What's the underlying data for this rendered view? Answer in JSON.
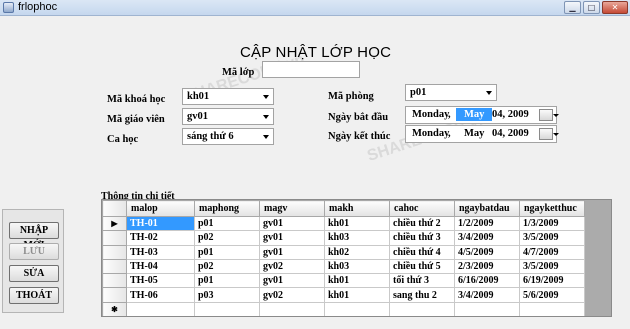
{
  "window": {
    "title": "frlophoc"
  },
  "heading": "CẬP NHẬT  LỚP HỌC",
  "fields": {
    "ma_lop": {
      "label": "Mã lớp",
      "value": ""
    },
    "ma_khoa_hoc": {
      "label": "Mã khoá học",
      "value": "kh01"
    },
    "ma_giao_vien": {
      "label": "Mã giáo viên",
      "value": "gv01"
    },
    "ca_hoc": {
      "label": "Ca học",
      "value": "sáng thứ 6"
    },
    "ma_phong": {
      "label": "Mã phòng",
      "value": "p01"
    },
    "ngay_bat_dau": {
      "label": "Ngày bắt đầu",
      "weekday": "Monday",
      "sep": ",",
      "month": "May",
      "day_year": "04, 2009"
    },
    "ngay_ket_thuc": {
      "label": "Ngày kết thúc",
      "weekday": "Monday",
      "sep": ",",
      "month": "May",
      "day_year": "04, 2009"
    }
  },
  "buttons": {
    "nhap_moi": "NHẬP MỚI",
    "luu": "LƯU",
    "sua": "SỬA",
    "thoat": "THOÁT"
  },
  "grid": {
    "title": "Thông tin chi tiết",
    "columns": [
      "malop",
      "maphong",
      "magv",
      "makh",
      "cahoc",
      "ngaybatdau",
      "ngayketthuc"
    ],
    "rows": [
      [
        "TH-01",
        "p01",
        "gv01",
        "kh01",
        "chiều thứ 2",
        "1/2/2009",
        "1/3/2009"
      ],
      [
        "TH-02",
        "p02",
        "gv01",
        "kh03",
        "chiều thứ 3",
        "3/4/2009",
        "3/5/2009"
      ],
      [
        "TH-03",
        "p01",
        "gv01",
        "kh02",
        "chiều thứ 4",
        "4/5/2009",
        "4/7/2009"
      ],
      [
        "TH-04",
        "p02",
        "gv02",
        "kh03",
        "chiều thứ 5",
        "2/3/2009",
        "3/5/2009"
      ],
      [
        "TH-05",
        "p01",
        "gv01",
        "kh01",
        "tối thứ 3",
        "6/16/2009",
        "6/19/2009"
      ],
      [
        "TH-06",
        "p03",
        "gv02",
        "kh01",
        "sang thu 2",
        "3/4/2009",
        "5/6/2009"
      ]
    ],
    "current_row_marker": "▶",
    "new_row_marker": "✱"
  },
  "icons": {
    "minimize": "minimize-icon",
    "maximize": "maximize-icon",
    "close": "close-icon"
  },
  "watermark": "SHARECODE.vn"
}
